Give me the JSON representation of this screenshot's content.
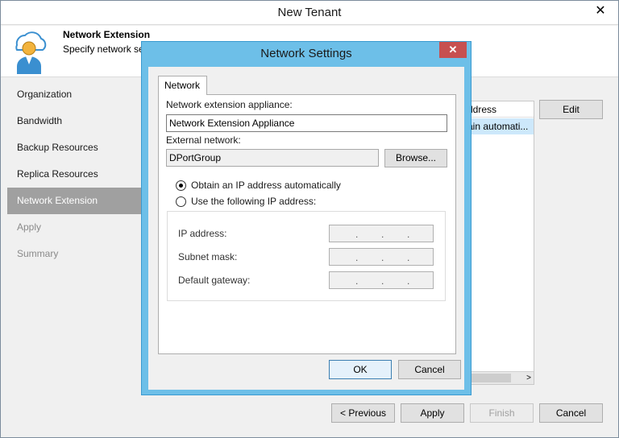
{
  "window": {
    "title": "New Tenant",
    "close_glyph": "✕"
  },
  "header": {
    "title": "Network Extension",
    "subtitle": "Specify network se",
    "icon": "tenant-avatar-icon"
  },
  "nav": {
    "items": [
      {
        "label": "Organization",
        "state": "normal"
      },
      {
        "label": "Bandwidth",
        "state": "normal"
      },
      {
        "label": "Backup Resources",
        "state": "normal"
      },
      {
        "label": "Replica Resources",
        "state": "normal"
      },
      {
        "label": "Network Extension",
        "state": "active"
      },
      {
        "label": "Apply",
        "state": "disabled"
      },
      {
        "label": "Summary",
        "state": "disabled"
      }
    ]
  },
  "background_table": {
    "header": "ddress",
    "row": "ain automati..."
  },
  "background_buttons": {
    "edit": "Edit",
    "previous": "< Previous",
    "apply": "Apply",
    "finish": "Finish",
    "cancel": "Cancel"
  },
  "dialog": {
    "title": "Network Settings",
    "close_glyph": "✕",
    "tab": "Network",
    "appliance_label": "Network extension appliance:",
    "appliance_value": "Network Extension Appliance",
    "external_label": "External network:",
    "external_value": "DPortGroup",
    "browse": "Browse...",
    "radio_auto": "Obtain an IP address automatically",
    "radio_manual": "Use the following IP address:",
    "ip_label": "IP address:",
    "subnet_label": "Subnet mask:",
    "gateway_label": "Default gateway:",
    "ok": "OK",
    "cancel": "Cancel"
  },
  "colors": {
    "dialog_frame": "#6dbfe8",
    "close_red": "#c75050",
    "nav_active": "#a0a0a0",
    "row_selected": "#cde8fb"
  }
}
